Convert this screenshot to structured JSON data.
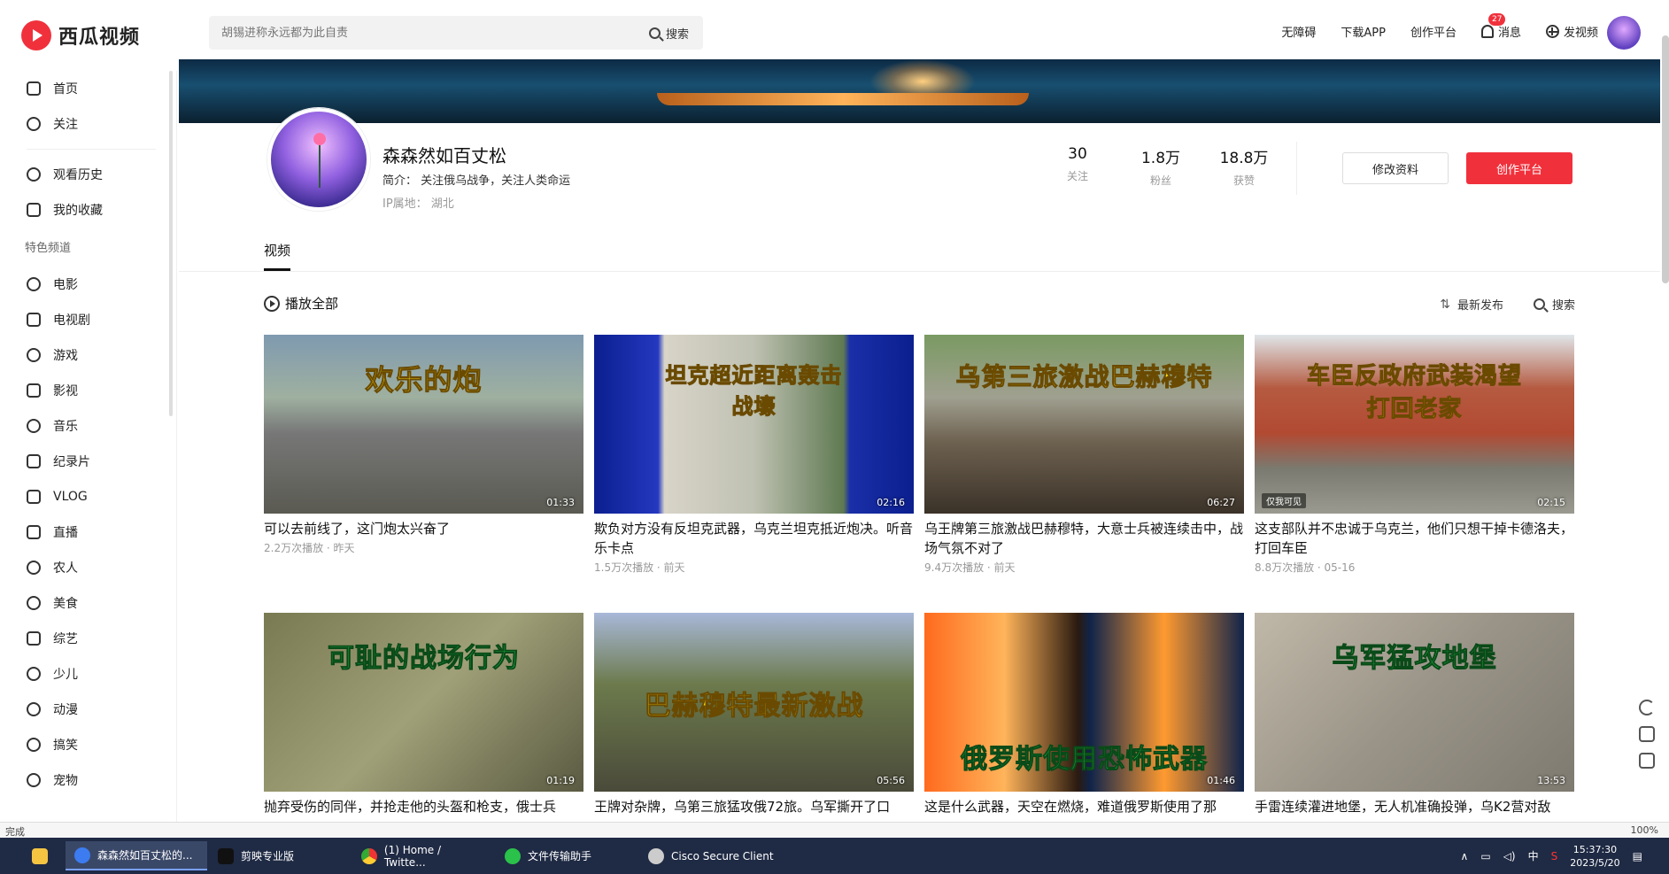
{
  "app": {
    "logo": "西瓜视频"
  },
  "search": {
    "placeholder": "胡锡进称永远都为此自责",
    "button": "搜索"
  },
  "topnav": {
    "accessibility": "无障碍",
    "download": "下载APP",
    "creator": "创作平台",
    "messages": "消息",
    "message_count": "27",
    "upload": "发视频"
  },
  "sidebar": {
    "items": [
      "首页",
      "关注"
    ],
    "personal": [
      "观看历史",
      "我的收藏"
    ],
    "section_title": "特色频道",
    "channels": [
      "电影",
      "电视剧",
      "游戏",
      "影视",
      "音乐",
      "纪录片",
      "VLOG",
      "直播",
      "农人",
      "美食",
      "综艺",
      "少儿",
      "动漫",
      "搞笑",
      "宠物"
    ]
  },
  "profile": {
    "name": "森森然如百丈松",
    "desc": "简介：  关注俄乌战争，关注人类命运",
    "ip": "IP属地：  湖北",
    "stats": [
      {
        "num": "30",
        "label": "关注"
      },
      {
        "num": "1.8万",
        "label": "粉丝"
      },
      {
        "num": "18.8万",
        "label": "获赞"
      }
    ],
    "edit_button": "修改资料",
    "create_button": "创作平台"
  },
  "tabs": {
    "active": "视频"
  },
  "toolbar": {
    "play_all": "播放全部",
    "sort": "最新发布",
    "search": "搜索"
  },
  "videos": [
    {
      "overlay": "欢乐的炮",
      "duration": "01:33",
      "title": "可以去前线了，这门炮太兴奋了",
      "meta": "2.2万次播放 · 昨天"
    },
    {
      "overlay": "坦克超近距离轰击战壕",
      "duration": "02:16",
      "title": "欺负对方没有反坦克武器，乌克兰坦克抵近炮决。听音乐卡点",
      "meta": "1.5万次播放 · 前天"
    },
    {
      "overlay": "乌第三旅激战巴赫穆特",
      "duration": "06:27",
      "title": "乌王牌第三旅激战巴赫穆特，大意士兵被连续击中，战场气氛不对了",
      "meta": "9.4万次播放 · 前天"
    },
    {
      "overlay": "车臣反政府武装渴望打回老家",
      "duration": "02:15",
      "private": "仅我可见",
      "title": "这支部队并不忠诚于乌克兰，他们只想干掉卡德洛夫，打回车臣",
      "meta": "8.8万次播放 · 05-16"
    },
    {
      "overlay": "可耻的战场行为",
      "duration": "01:19",
      "title": "抛弃受伤的同伴，并抢走他的头盔和枪支，俄士兵",
      "meta": ""
    },
    {
      "overlay": "巴赫穆特最新激战",
      "duration": "05:56",
      "title": "王牌对杂牌，乌第三旅猛攻俄72旅。乌军撕开了口",
      "meta": ""
    },
    {
      "overlay": "俄罗斯使用恐怖武器",
      "duration": "01:46",
      "title": "这是什么武器，天空在燃烧，难道俄罗斯使用了那",
      "meta": ""
    },
    {
      "overlay": "乌军猛攻地堡",
      "duration": "13:53",
      "title": "手雷连续灌进地堡，无人机准确投弹，乌K2营对敌",
      "meta": ""
    }
  ],
  "statusbar": {
    "status": "完成",
    "zoom": "100%"
  },
  "taskbar": {
    "tasks": [
      "森森然如百丈松的...",
      "剪映专业版",
      "(1) Home / Twitte...",
      "文件传输助手",
      "Cisco Secure Client"
    ],
    "time": "15:37:30",
    "date": "2023/5/20",
    "ime": "中"
  }
}
